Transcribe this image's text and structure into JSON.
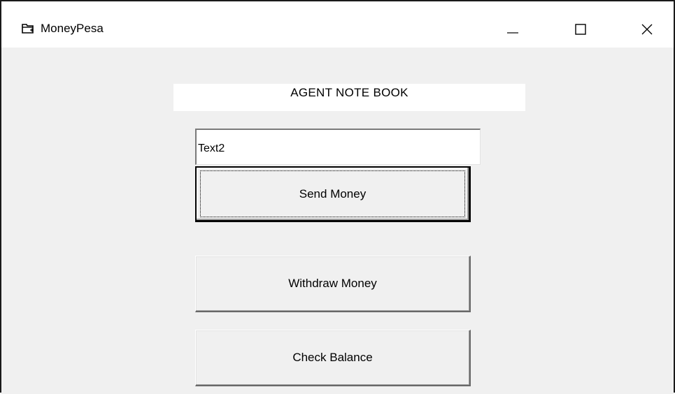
{
  "window": {
    "title": "MoneyPesa",
    "icon": "app-window-icon",
    "controls": {
      "minimize_icon": "minimize-icon",
      "maximize_icon": "maximize-icon",
      "close_icon": "close-icon"
    }
  },
  "form": {
    "heading": "AGENT NOTE BOOK",
    "text_input_value": "Text2",
    "buttons": {
      "send": "Send Money",
      "withdraw": "Withdraw Money",
      "check": "Check Balance"
    }
  },
  "colors": {
    "form_background": "#f0f0f0",
    "titlebar_background": "#ffffff",
    "window_border": "#1a1a1a"
  }
}
